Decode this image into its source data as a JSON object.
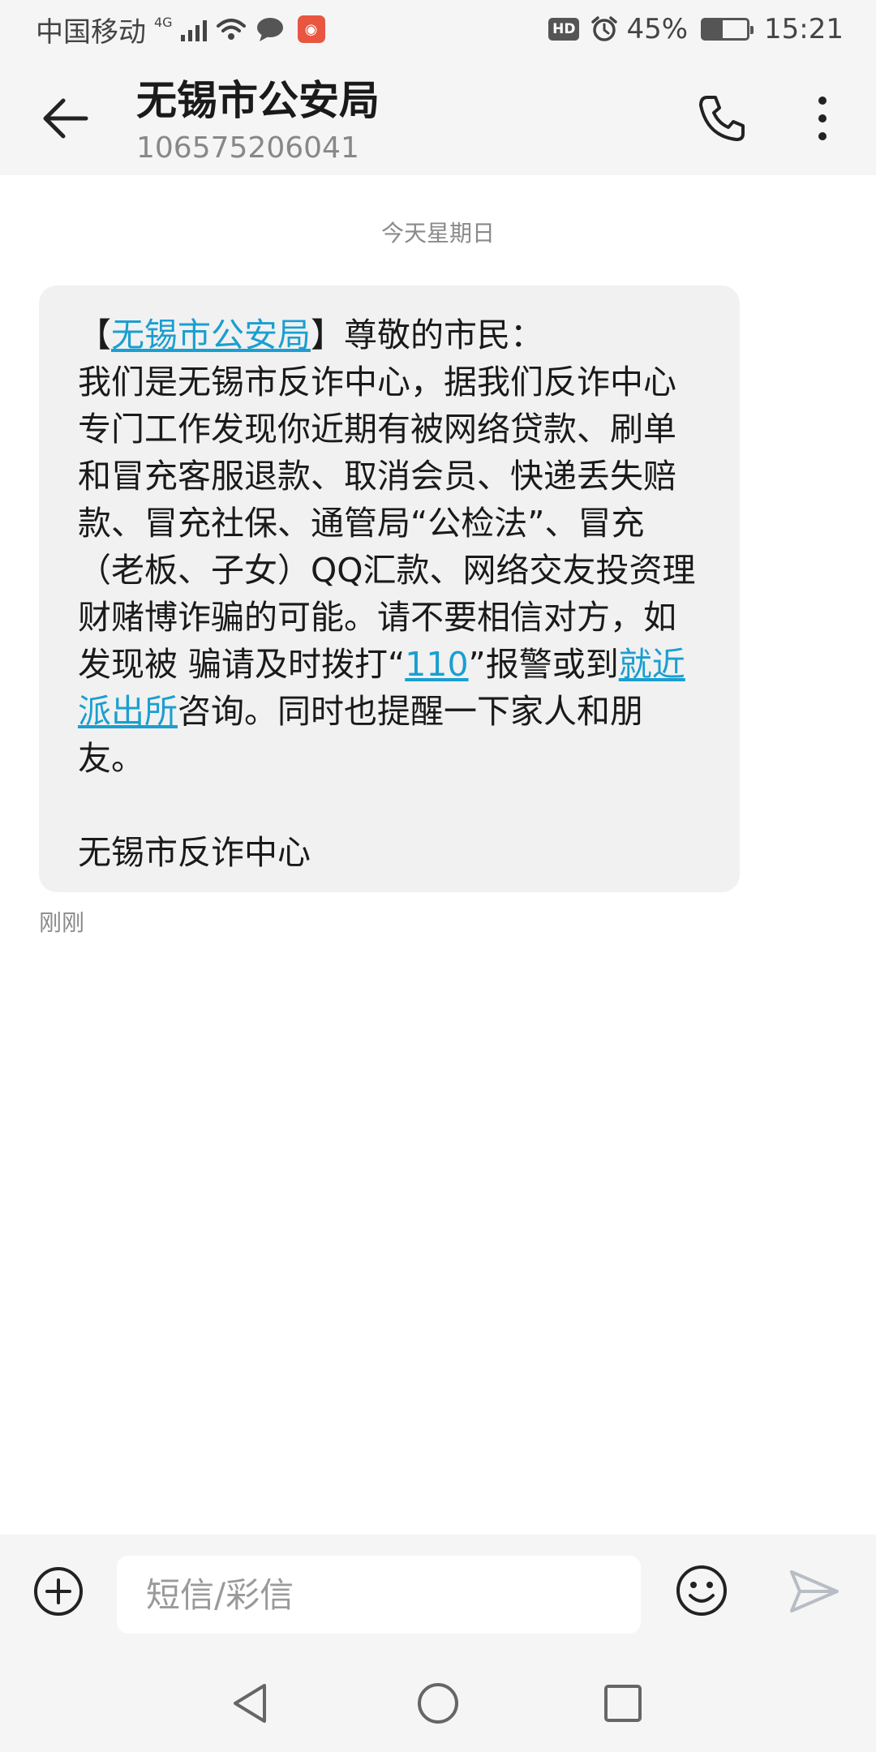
{
  "status_bar": {
    "carrier": "中国移动",
    "network": "4G",
    "battery_percent": "45%",
    "battery_level": 0.45,
    "time": "15:21",
    "hd_label": "HD",
    "icons": [
      "signal-icon",
      "wifi-icon",
      "chat-bubble-icon",
      "app-badge-icon",
      "hd-icon",
      "alarm-icon",
      "battery-charging-icon"
    ]
  },
  "header": {
    "contact_name": "无锡市公安局",
    "contact_number": "106575206041",
    "icons": [
      "back-arrow-icon",
      "phone-icon",
      "more-vertical-icon"
    ]
  },
  "conversation": {
    "date_divider": "今天星期日",
    "message": {
      "bracket_open": "【",
      "sender_link": "无锡市公安局",
      "bracket_close_greeting": "】尊敬的市民：",
      "body_part1": "我们是无锡市反诈中心，据我们反诈中心专门工作发现你近期有被网络贷款、刷单和冒充客服退款、取消会员、快递丢失赔款、冒充社保、通管局“公检法”、冒充（老板、子女）QQ汇款、网络交友投资理财赌博诈骗的可能。请不要相信对方，如发现被 骗请及时拨打“",
      "phone_link": "110",
      "body_part2": "”报警或到",
      "location_link": "就近派出所",
      "body_part3": "咨询。同时也提醒一下家人和朋友。",
      "signature": "无锡市反诈中心"
    },
    "timestamp": "刚刚"
  },
  "input_bar": {
    "placeholder": "短信/彩信",
    "value": "",
    "icons": [
      "add-circle-icon",
      "emoji-icon",
      "send-icon"
    ]
  },
  "nav_bar": {
    "icons": [
      "nav-back-icon",
      "nav-home-icon",
      "nav-recents-icon"
    ]
  },
  "colors": {
    "link": "#1a9fd0",
    "bubble": "#f1f1f1",
    "bar_background": "#f5f5f5"
  }
}
